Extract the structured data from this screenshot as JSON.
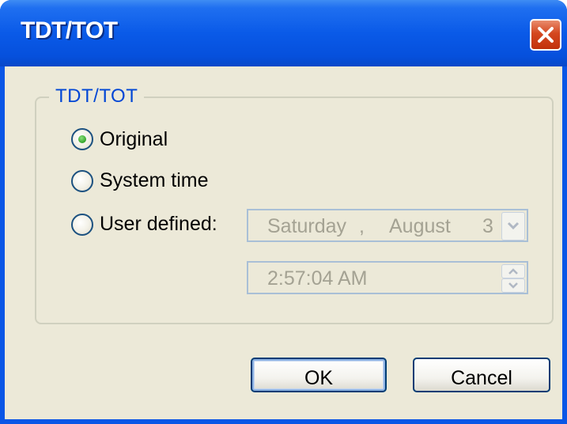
{
  "window": {
    "title": "TDT/TOT"
  },
  "group": {
    "label": "TDT/TOT"
  },
  "options": [
    {
      "label": "Original",
      "selected": true
    },
    {
      "label": "System time",
      "selected": false
    },
    {
      "label": "User defined:",
      "selected": false
    }
  ],
  "date_picker": {
    "day": "Saturday",
    "sep": ",",
    "month": "August",
    "date_fragment": "3",
    "enabled": false
  },
  "time_picker": {
    "value": "2:57:04 AM",
    "enabled": false
  },
  "buttons": {
    "ok": "OK",
    "cancel": "Cancel"
  },
  "colors": {
    "titlebar": "#0a56e6",
    "client": "#ece9d8",
    "group_label": "#0046d5",
    "disabled_text": "#a4a293",
    "close_button": "#d4471f"
  },
  "icons": {
    "close": "close-x-icon",
    "dropdown": "chevron-down-icon",
    "spin_up": "spin-up-icon",
    "spin_down": "spin-down-icon"
  }
}
